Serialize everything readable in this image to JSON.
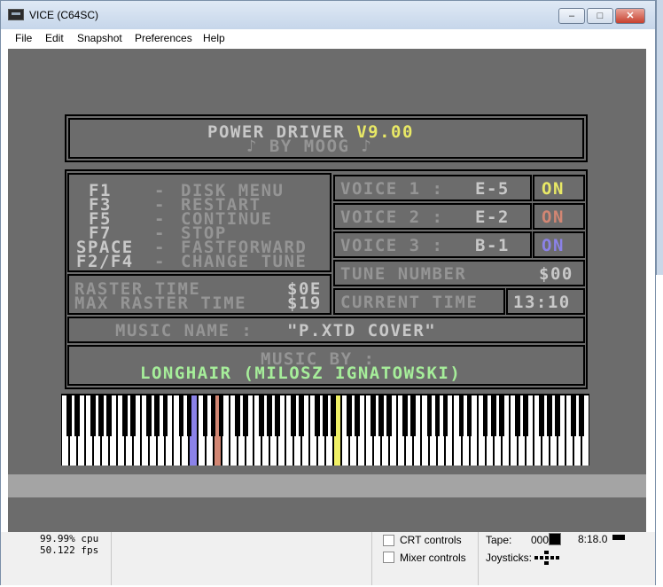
{
  "window": {
    "title": "VICE (C64SC)"
  },
  "menu": [
    "File",
    "Edit",
    "Snapshot",
    "Preferences",
    "Help"
  ],
  "player": {
    "title_line": "POWER DRIVER",
    "version": "V9.00",
    "by_line": "♪ BY MOOG ♪",
    "keys": [
      {
        "key": "F1",
        "dash": "-",
        "action": "DISK MENU"
      },
      {
        "key": "F3",
        "dash": "-",
        "action": "RESTART"
      },
      {
        "key": "F5",
        "dash": "-",
        "action": "CONTINUE"
      },
      {
        "key": "F7",
        "dash": "-",
        "action": "STOP"
      },
      {
        "key": "SPACE",
        "dash": "-",
        "action": "FASTFORWARD"
      },
      {
        "key": "F2/F4",
        "dash": "-",
        "action": "CHANGE TUNE"
      }
    ],
    "raster_time_label": "RASTER TIME",
    "raster_time_value": "$0E",
    "max_raster_time_label": "MAX RASTER TIME",
    "max_raster_time_value": "$19",
    "voices": [
      {
        "label": "VOICE 1 :",
        "note": "E-5",
        "state": "ON",
        "color": "#e8e866"
      },
      {
        "label": "VOICE 2 :",
        "note": "E-2",
        "state": "ON",
        "color": "#d28673"
      },
      {
        "label": "VOICE 3 :",
        "note": "B-1",
        "state": "ON",
        "color": "#8b82e8"
      }
    ],
    "tune_number_label": "TUNE NUMBER",
    "tune_number_value": "$00",
    "current_time_label": "CURRENT TIME",
    "current_time_value": "13:10",
    "music_name_label": "MUSIC NAME :",
    "music_name_value": "\"P.XTD COVER\"",
    "music_by_label": "MUSIC BY :",
    "music_by_value": "LONGHAIR (MILOSZ IGNATOWSKI)",
    "highlight_keys": [
      {
        "index": 16,
        "color": "#8b82e8"
      },
      {
        "index": 19,
        "color": "#d28673"
      },
      {
        "index": 34,
        "color": "#f0f066"
      }
    ]
  },
  "status": {
    "cpu": "99.99% cpu",
    "fps": "50.122 fps",
    "crt_controls": "CRT controls",
    "mixer_controls": "Mixer controls",
    "tape_label": "Tape:",
    "tape_counter": "000",
    "tape_time": "8:18.0",
    "joysticks_label": "Joysticks:"
  },
  "colors": {
    "c64_gray": "#959595",
    "c64_bg": "#6c6c6c",
    "c64_yellow": "#e8e866",
    "c64_green": "#a6ee9a",
    "c64_light_gray": "#c8c8c8"
  }
}
